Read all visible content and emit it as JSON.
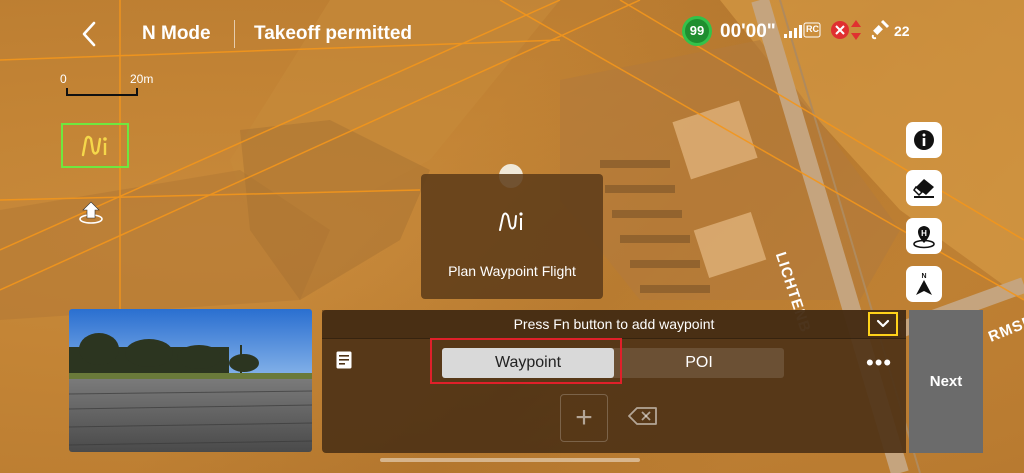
{
  "topbar": {
    "mode": "N Mode",
    "status": "Takeoff permitted",
    "battery": "99",
    "flight_time": "00'00\"",
    "rc_label": "RC",
    "satellites": "22"
  },
  "scale": {
    "min": "0",
    "max": "20m"
  },
  "map_labels": {
    "road1": "LICHTENB",
    "road2": "RMSP"
  },
  "plan_card": {
    "label": "Plan Waypoint Flight"
  },
  "panel": {
    "hint": "Press Fn button to add waypoint",
    "tabs": [
      {
        "label": "Waypoint",
        "active": true
      },
      {
        "label": "POI",
        "active": false
      }
    ],
    "more": "•••",
    "add": "+"
  },
  "next_button": {
    "label": "Next"
  },
  "colors": {
    "accent_green": "#6ee83f",
    "highlight_red": "#e0202a",
    "collapse_yellow": "#ffd21a",
    "battery_green": "#33c24a"
  },
  "icons": [
    "back-icon",
    "battery-icon",
    "rc-signal-icon",
    "warning-icon",
    "satellite-icon",
    "route-icon",
    "takeoff-icon",
    "info-icon",
    "eraser-icon",
    "home-point-icon",
    "north-icon",
    "chevron-down-icon",
    "list-icon",
    "backspace-icon"
  ]
}
